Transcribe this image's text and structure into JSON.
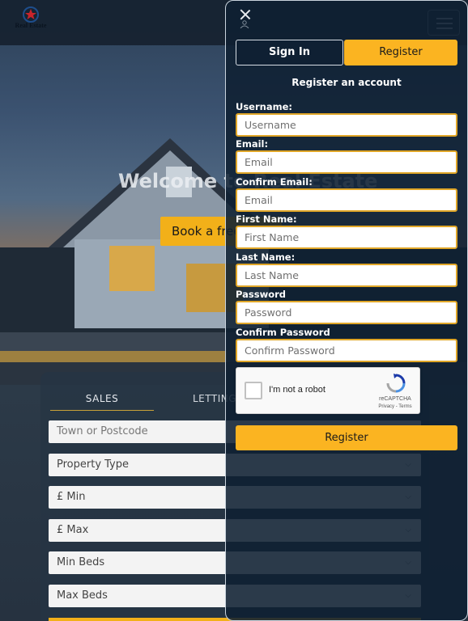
{
  "brand": {
    "logo_text": "Real Estate"
  },
  "hero": {
    "title": "Welcome to Real Estate",
    "cta_label": "Book a free valuation"
  },
  "search": {
    "tabs": [
      "SALES",
      "LETTINGS"
    ],
    "location_placeholder": "Town or Postcode",
    "selects": [
      "Property Type",
      "£ Min",
      "£ Max",
      "Min Beds",
      "Max Beds"
    ]
  },
  "auth": {
    "tabs": {
      "sign_in": "Sign In",
      "register": "Register"
    },
    "heading": "Register an account",
    "fields": {
      "username": {
        "label": "Username:",
        "placeholder": "Username"
      },
      "email": {
        "label": "Email:",
        "placeholder": "Email"
      },
      "confirm_email": {
        "label": "Confirm Email:",
        "placeholder": "Email"
      },
      "first_name": {
        "label": "First Name:",
        "placeholder": "First Name"
      },
      "last_name": {
        "label": "Last Name:",
        "placeholder": "Last Name"
      },
      "password": {
        "label": "Password",
        "placeholder": "Password"
      },
      "confirm_password": {
        "label": "Confirm Password",
        "placeholder": "Confirm Password"
      }
    },
    "captcha": {
      "label": "I'm not a robot",
      "brand": "reCAPTCHA",
      "links": "Privacy - Terms"
    },
    "submit_label": "Register"
  },
  "colors": {
    "accent": "#fbb421",
    "panel": "#0f2033",
    "input_border": "#e0a627"
  },
  "icons": [
    "close-icon",
    "person-icon",
    "hamburger-icon",
    "chevron-down-icon",
    "recaptcha-icon"
  ]
}
